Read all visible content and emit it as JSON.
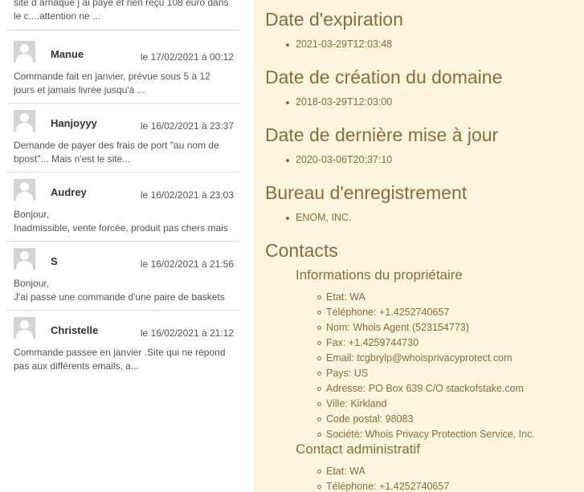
{
  "comments_panel": {
    "first_snippet": {
      "line1": "site d arnaque j ai paye et rien reçu 108 euro dans",
      "line2": "le c....attention ne ..."
    },
    "comments": [
      {
        "author": "Manue",
        "date": "le 17/02/2021 à 00:12",
        "line1": "Commande fait en janvier, prévue sous 5 à 12",
        "line2": "jours et jamais livrée jusqu'à ..."
      },
      {
        "author": "Hanjoyyy",
        "date": "le 16/02/2021 à 23:37",
        "line1": "Demande de payer des frais de port \"au nom de",
        "line2": "bpost\"... Mais n'est le site..."
      },
      {
        "author": "Audrey",
        "date": "le 16/02/2021 à 23:03",
        "line1": "Bonjour,",
        "line2": "Inadmissible, vente forcée, produit pas chers mais"
      },
      {
        "author": "S",
        "date": "le 16/02/2021 à 21:56",
        "line1": "Bonjour,",
        "line2": "J'ai passé une commande d'une paire de baskets"
      },
      {
        "author": "Christelle",
        "date": "le 16/02/2021 à 21:12",
        "line1": "Commande passee en janvier .Site qui ne répond",
        "line2": "pas aux différents emails, a..."
      }
    ]
  },
  "whois": {
    "expiration": {
      "title": "Date d'expiration",
      "value": "2021-03-29T12:03:48"
    },
    "creation": {
      "title": "Date de création du domaine",
      "value": "2018-03-29T12:03:00"
    },
    "updated": {
      "title": "Date de dernière mise à jour",
      "value": "2020-03-06T20:37:10"
    },
    "registrar": {
      "title": "Bureau d'enregistrement",
      "value": "ENOM, INC."
    },
    "contacts_title": "Contacts",
    "owner": {
      "title": "Informations du propriétaire",
      "items": [
        "Etat: WA",
        "Téléphone: +1.4252740657",
        "Nom: Whois Agent (523154773)",
        "Fax: +1.4259744730",
        "Email: tcgbrylp@whoisprivacyprotect.com",
        "Pays: US",
        "Adresse: PO Box 639 C/O stackofstake.com",
        "Ville: Kirkland",
        "Code postal: 98083",
        "Société: Whois Privacy Protection Service, Inc."
      ]
    },
    "admin": {
      "title": "Contact administratif",
      "items": [
        "Etat: WA",
        "Téléphone: +1.4252740657"
      ]
    }
  }
}
